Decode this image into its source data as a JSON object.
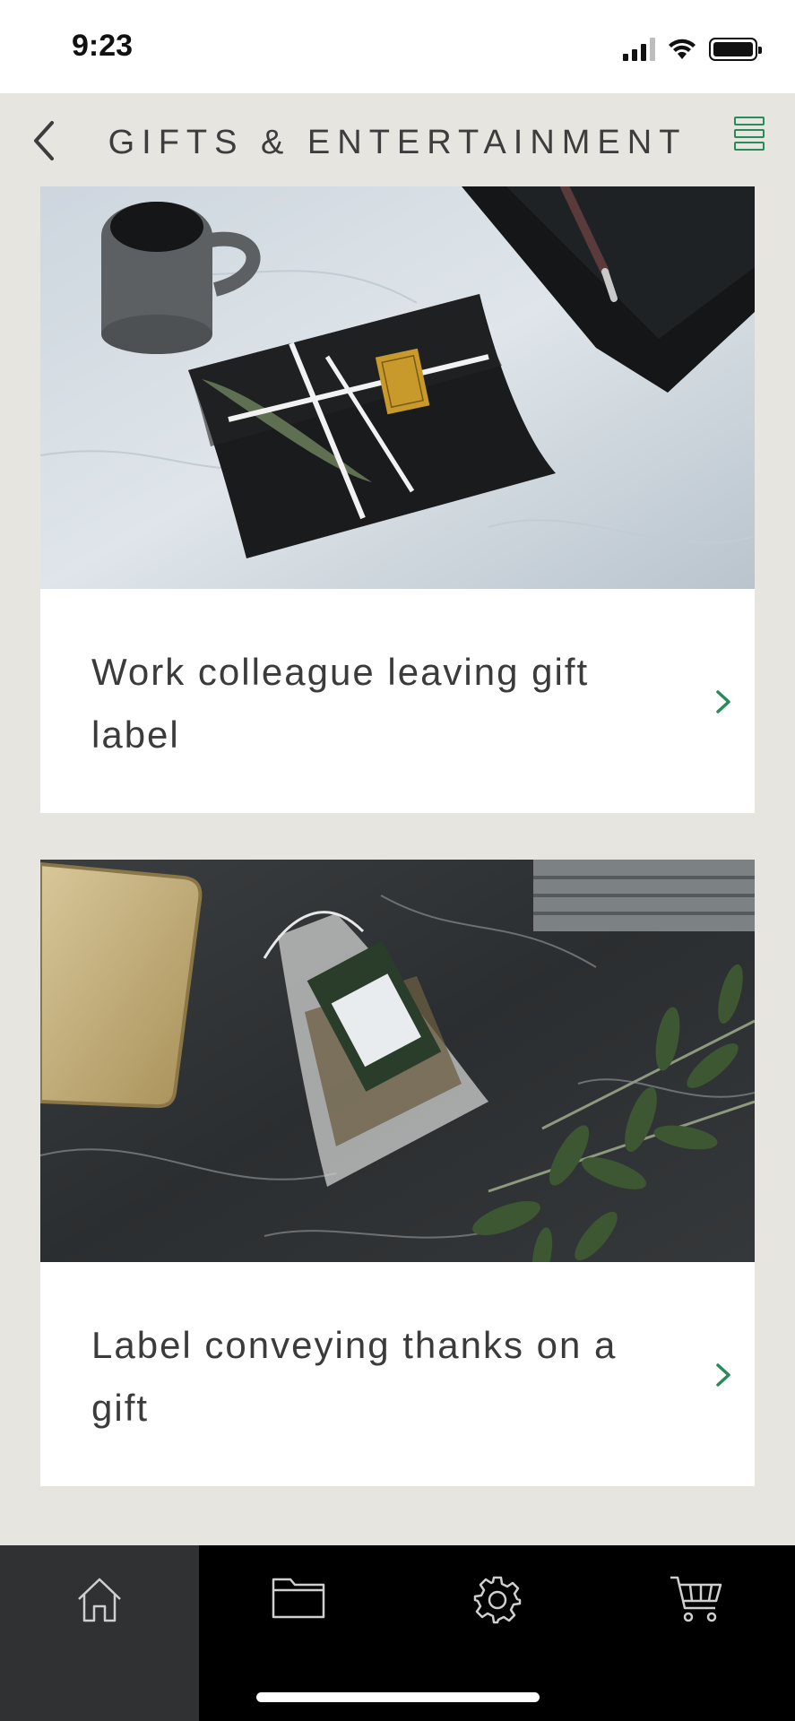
{
  "status_bar": {
    "time": "9:23"
  },
  "header": {
    "title": "GIFTS & ENTERTAINMENT"
  },
  "cards": [
    {
      "title": "Work colleague leaving gift label",
      "image": "black-gift-box-photo"
    },
    {
      "title": "Label conveying thanks on a gift",
      "image": "organza-gift-bag-photo"
    }
  ],
  "tab_bar": {
    "tabs": [
      {
        "icon": "home-icon",
        "active": true
      },
      {
        "icon": "folder-icon",
        "active": false
      },
      {
        "icon": "gear-icon",
        "active": false
      },
      {
        "icon": "cart-icon",
        "active": false
      }
    ]
  },
  "colors": {
    "accent": "#2a8a5a",
    "background": "#e7e5e0",
    "tab_bar": "#000000",
    "tab_active": "#2f3132"
  }
}
